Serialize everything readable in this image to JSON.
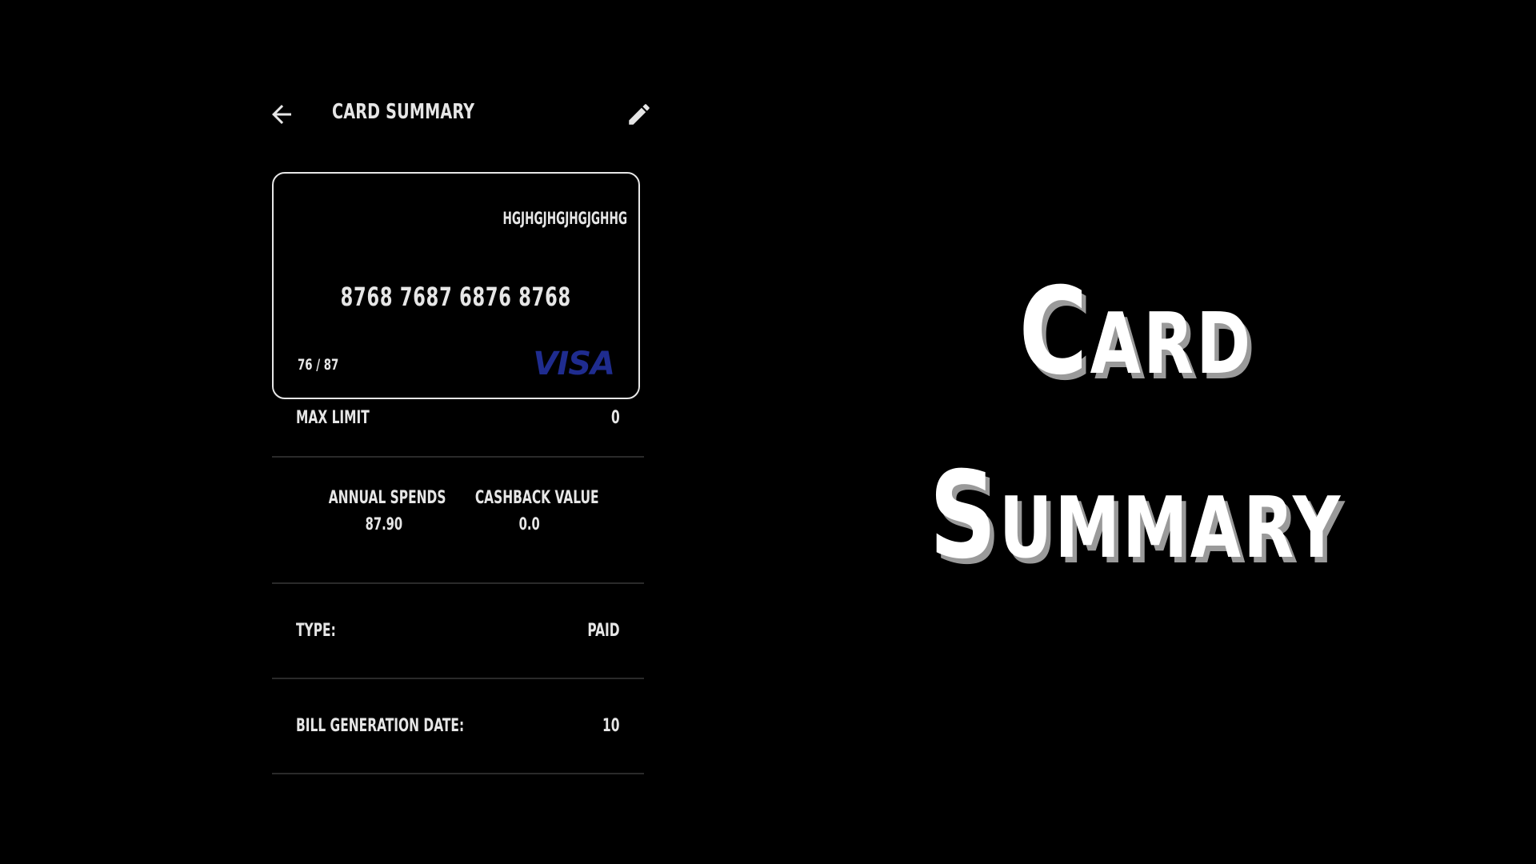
{
  "header": {
    "title": "CARD SUMMARY",
    "back_icon": "arrow-left-icon",
    "edit_icon": "pencil-icon"
  },
  "card": {
    "holder_name": "HGJHGJHGJHGJGHHG",
    "number": "8768 7687 6876 8768",
    "expiry": "76 / 87",
    "network": "VISA",
    "network_color": "#1f2c8f",
    "border_color": "#e6e6e6"
  },
  "details": {
    "max_limit": {
      "label": "MAX LIMIT",
      "value": "0"
    },
    "annual_spends": {
      "label": "ANNUAL SPENDS",
      "value": "87.90"
    },
    "cashback_value": {
      "label": "CASHBACK VALUE",
      "value": "0.0"
    },
    "type": {
      "label": "TYPE:",
      "value": "PAID"
    },
    "bill_generation_date": {
      "label": "BILL GENERATION DATE:",
      "value": "10"
    }
  },
  "hero": {
    "line1": "Card",
    "line2": "Summary",
    "text_color": "#ffffff",
    "shadow_color": "#9a9a9a"
  },
  "theme": {
    "background": "#000000",
    "divider": "#2a2a2a"
  }
}
